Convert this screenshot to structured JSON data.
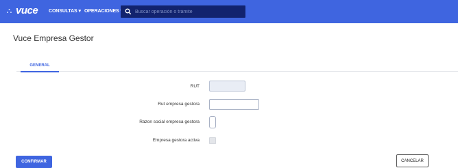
{
  "header": {
    "logo_text": "vuce",
    "nav": {
      "consultas_label": "CONSULTAS ▾",
      "operaciones_label": "OPERACIONES ▾"
    },
    "search": {
      "placeholder": "Buscar operación o trámite",
      "value": ""
    }
  },
  "page": {
    "title": "Vuce Empresa Gestor"
  },
  "tabs": [
    {
      "label": "GENERAL",
      "active": true
    }
  ],
  "form": {
    "rut_label": "RUT",
    "rut_value": "",
    "rut_gestora_label": "Rut empresa gestora",
    "rut_gestora_value": "",
    "razon_social_label": "Razon social empresa gestora",
    "razon_social_value": "",
    "activa_label": "Empresa gestora activa",
    "activa_checked": false
  },
  "actions": {
    "confirm_label": "CONFIRMAR",
    "cancel_label": "CANCELAR"
  },
  "colors": {
    "brand_blue": "#3f65e0",
    "search_bg": "#12236e"
  }
}
